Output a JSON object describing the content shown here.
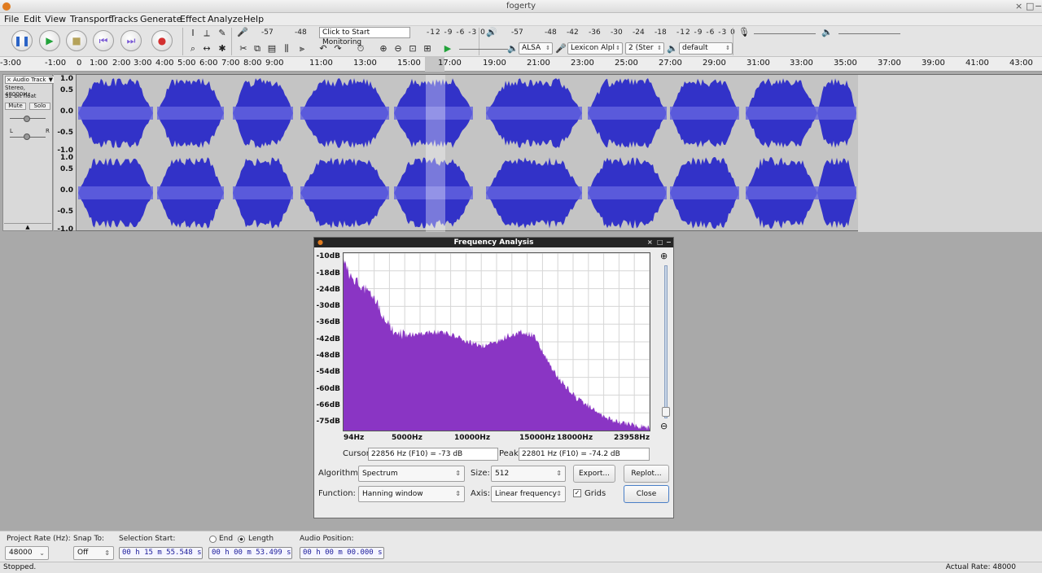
{
  "window": {
    "title": "fogerty"
  },
  "menu": [
    "File",
    "Edit",
    "View",
    "Transport",
    "Tracks",
    "Generate",
    "Effect",
    "Analyze",
    "Help"
  ],
  "toolbar": {
    "rec_meter_values": [
      "-57",
      "-48",
      "-12",
      "-9",
      "-6",
      "-3",
      "0"
    ],
    "monitor_label": "Click to Start Monitoring",
    "play_meter_values": [
      "-57",
      "-48",
      "-42",
      "-36",
      "-30",
      "-24",
      "-18",
      "-12",
      "-9",
      "-6",
      "-3",
      "0"
    ],
    "host": "ALSA",
    "rec_device": "Lexicon Alpl",
    "channels": "2 (Ster",
    "play_device": "default"
  },
  "ruler": [
    "-3:00",
    "-1:00",
    "0",
    "1:00",
    "2:00",
    "3:00",
    "4:00",
    "5:00",
    "6:00",
    "7:00",
    "8:00",
    "9:00",
    "11:00",
    "13:00",
    "15:00",
    "17:00",
    "19:00",
    "21:00",
    "23:00",
    "25:00",
    "27:00",
    "29:00",
    "31:00",
    "33:00",
    "35:00",
    "37:00",
    "39:00",
    "41:00",
    "43:00"
  ],
  "track": {
    "name": "Audio Track",
    "info1": "Stereo, 48000Hz",
    "info2": "32-bit float",
    "mute": "Mute",
    "solo": "Solo",
    "pan_l": "L",
    "pan_r": "R",
    "scale": [
      "1.0",
      "0.5",
      "0.0",
      "-0.5",
      "-1.0"
    ],
    "color": "#3232c8"
  },
  "dialog": {
    "title": "Frequency Analysis",
    "db_labels": [
      "-10dB",
      "-18dB",
      "-24dB",
      "-30dB",
      "-36dB",
      "-42dB",
      "-48dB",
      "-54dB",
      "-60dB",
      "-66dB",
      "-75dB"
    ],
    "hz_labels": [
      "94Hz",
      "5000Hz",
      "10000Hz",
      "15000Hz",
      "18000Hz",
      "23958Hz"
    ],
    "cursor_label": "Cursor:",
    "cursor_value": "22856 Hz (F10) = -73 dB",
    "peak_label": "Peak:",
    "peak_value": "22801 Hz (F10) = -74.2 dB",
    "algorithm_label": "Algorithm:",
    "algorithm_value": "Spectrum",
    "size_label": "Size:",
    "size_value": "512",
    "export_label": "Export...",
    "replot_label": "Replot...",
    "function_label": "Function:",
    "function_value": "Hanning window",
    "axis_label": "Axis:",
    "axis_value": "Linear frequency",
    "grids_label": "Grids",
    "close_label": "Close",
    "spectrum_color": "#8a35c4"
  },
  "selection": {
    "rate_label": "Project Rate (Hz):",
    "rate_value": "48000",
    "snap_label": "Snap To:",
    "snap_value": "Off",
    "start_label": "Selection Start:",
    "start_value": "00 h 15 m 55.548 s",
    "end_label": "End",
    "length_label": "Length",
    "length_value": "00 h 00 m 53.499 s",
    "pos_label": "Audio Position:",
    "pos_value": "00 h 00 m 00.000 s"
  },
  "status": {
    "left": "Stopped.",
    "right": "Actual Rate: 48000"
  }
}
